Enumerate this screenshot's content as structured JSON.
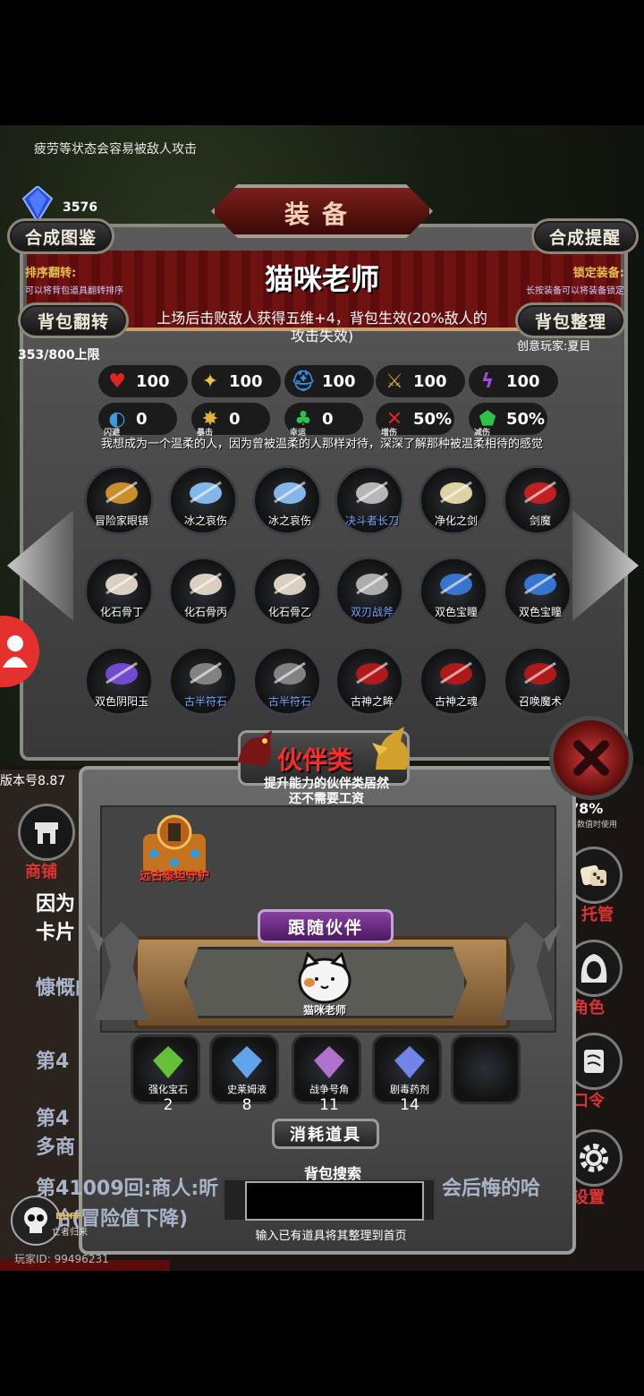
{
  "tip": "疲劳等状态会容易被敌人攻击",
  "crystal_count": "3576",
  "buttons": {
    "compose_catalog": "合成图鉴",
    "compose_reminder": "合成提醒",
    "bag_flip": "背包翻转",
    "bag_sort": "背包整理"
  },
  "badge": "装备",
  "header": {
    "left_title": "排序翻转:",
    "left_sub": "可以将背包道具翻转排序",
    "right_title": "锁定装备:",
    "right_sub": "长按装备可以将装备锁定"
  },
  "item": {
    "name": "猫咪老师",
    "desc": "上场后击败敌人获得五维+4，背包生效(20%敌人的攻击失效)",
    "creator": "创意玩家:夏目",
    "quote": "我想成为一个温柔的人，因为曾被温柔的人那样对待，深深了解那种被温柔相待的感觉"
  },
  "capacity": "353/800上限",
  "stats_row1": [
    {
      "icon": "heart-icon",
      "glyph": "♥",
      "color": "#e02424",
      "value": "100"
    },
    {
      "icon": "strength-icon",
      "glyph": "✦",
      "color": "#e9c34a",
      "value": "100"
    },
    {
      "icon": "helmet-icon",
      "glyph": "⛑",
      "color": "#3a8de0",
      "value": "100"
    },
    {
      "icon": "sword-icon",
      "glyph": "⚔",
      "color": "#d8a23a",
      "value": "100"
    },
    {
      "icon": "lightning-icon",
      "glyph": "ϟ",
      "color": "#a04ae0",
      "value": "100"
    }
  ],
  "stats_row2": [
    {
      "icon": "dodge-icon",
      "glyph": "◐",
      "color": "#3a9be0",
      "label": "闪避",
      "value": "0"
    },
    {
      "icon": "crit-icon",
      "glyph": "✸",
      "color": "#e0b23a",
      "label": "暴击",
      "value": "0"
    },
    {
      "icon": "luck-icon",
      "glyph": "♣",
      "color": "#2ec24c",
      "label": "幸运",
      "value": "0"
    },
    {
      "icon": "damage-boost-icon",
      "glyph": "✕",
      "color": "#e02424",
      "label": "增伤",
      "value": "50%"
    },
    {
      "icon": "damage-reduce-icon",
      "glyph": "⬟",
      "color": "#2ec24c",
      "label": "减伤",
      "value": "50%"
    }
  ],
  "equipment_grid": [
    {
      "name": "冒险家眼镜",
      "blue": false,
      "icon": "goggles-icon",
      "color": "#d99a2b"
    },
    {
      "name": "冰之哀伤",
      "blue": false,
      "icon": "ice-sword-icon",
      "color": "#8fc7ff"
    },
    {
      "name": "冰之哀伤",
      "blue": false,
      "icon": "ice-sword-icon",
      "color": "#8fc7ff"
    },
    {
      "name": "决斗者长刀",
      "blue": true,
      "icon": "glaive-icon",
      "color": "#c7c7c7"
    },
    {
      "name": "净化之剑",
      "blue": false,
      "icon": "great-sword-icon",
      "color": "#f1e6b0"
    },
    {
      "name": "剑魔",
      "blue": false,
      "icon": "sword-demon-icon",
      "color": "#d12020"
    },
    {
      "name": "化石骨丁",
      "blue": false,
      "icon": "bone-icon",
      "color": "#eee2d0"
    },
    {
      "name": "化石骨丙",
      "blue": false,
      "icon": "bone-icon",
      "color": "#eee2d0"
    },
    {
      "name": "化石骨乙",
      "blue": false,
      "icon": "bone-icon",
      "color": "#eee2d0"
    },
    {
      "name": "双刃战斧",
      "blue": true,
      "icon": "axe-icon",
      "color": "#bdbdbd"
    },
    {
      "name": "双色宝瞳",
      "blue": false,
      "icon": "amulet-icon",
      "color": "#3a7de0"
    },
    {
      "name": "双色宝瞳",
      "blue": false,
      "icon": "amulet-icon",
      "color": "#3a7de0"
    },
    {
      "name": "双色阴阳玉",
      "blue": false,
      "icon": "yinyang-orb-icon",
      "color": "#7a4fe0"
    },
    {
      "name": "古半符石",
      "blue": true,
      "icon": "rune-stone-icon",
      "color": "#8d8d8d"
    },
    {
      "name": "古半符石",
      "blue": true,
      "icon": "rune-stone-icon",
      "color": "#8d8d8d"
    },
    {
      "name": "古神之眸",
      "blue": false,
      "icon": "eye-icon",
      "color": "#c01818"
    },
    {
      "name": "古神之魂",
      "blue": false,
      "icon": "soul-icon",
      "color": "#c01818"
    },
    {
      "name": "召唤魔术",
      "blue": false,
      "icon": "pentagram-icon",
      "color": "#c01818"
    }
  ],
  "companion": {
    "category": "伙伴类",
    "subtitle": "提升能力的伙伴类居然还不需要工资",
    "item_name": "远古泰坦守护",
    "follow_button": "跟随伙伴",
    "follow_name": "猫咪老师"
  },
  "consumables_header": "消耗道具",
  "consumables": [
    {
      "name": "强化宝石",
      "count": "2",
      "icon": "gem-icon",
      "color": "#6bd13a"
    },
    {
      "name": "史莱姆液",
      "count": "8",
      "icon": "potion-icon",
      "color": "#6ab2ff"
    },
    {
      "name": "战争号角",
      "count": "11",
      "icon": "horn-icon",
      "color": "#c17ae0"
    },
    {
      "name": "剧毒药剂",
      "count": "14",
      "icon": "poison-icon",
      "color": "#7a8fff"
    }
  ],
  "search": {
    "label": "背包搜索",
    "hint": "输入已有道具将其整理到首页",
    "value": ""
  },
  "left_panel": {
    "shop": "商铺",
    "line1": "因为",
    "line2": "卡片",
    "line3": "慷慨的",
    "line4": "第4",
    "line5": "第4",
    "line6": "多商",
    "log_main": "第41009回:商人:昕",
    "log_tail": "会后悔的哈",
    "log_next": "哈(冒险值下降)",
    "buff": "BUFF",
    "buff_sub": "亡者归来"
  },
  "right_panel": {
    "percent": "78%",
    "percent_note": "其数值时使用",
    "manage": "托管",
    "role": "角色",
    "password": "口令",
    "settings": "设置"
  },
  "version": "版本号8.87",
  "player_id": "玩家ID: 99496231"
}
